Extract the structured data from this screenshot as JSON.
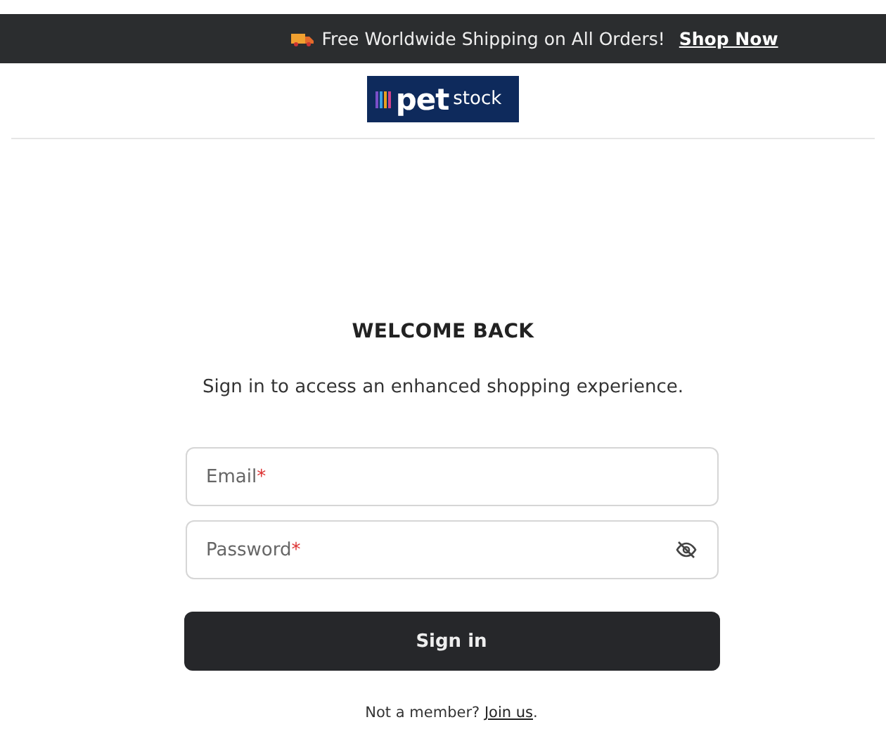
{
  "announcement_bar": {
    "text": "Free Worldwide Shipping on All Orders!",
    "link": "Shop Now"
  },
  "logo": {
    "bold": "pet",
    "light": "stock"
  },
  "heading": "WELCOME BACK",
  "subtitle": "Sign in to access an enhanced shopping experience.",
  "fields": [
    {
      "kind": "text",
      "placeholder": "Email",
      "required": true,
      "required_mark": "*"
    },
    {
      "kind": "password",
      "placeholder": "Password",
      "required": true,
      "required_mark": "*",
      "password_visible": false
    }
  ],
  "submit_button": "Sign in",
  "footer": {
    "text": "Not a member?",
    "link": "Join us",
    "end": "."
  }
}
